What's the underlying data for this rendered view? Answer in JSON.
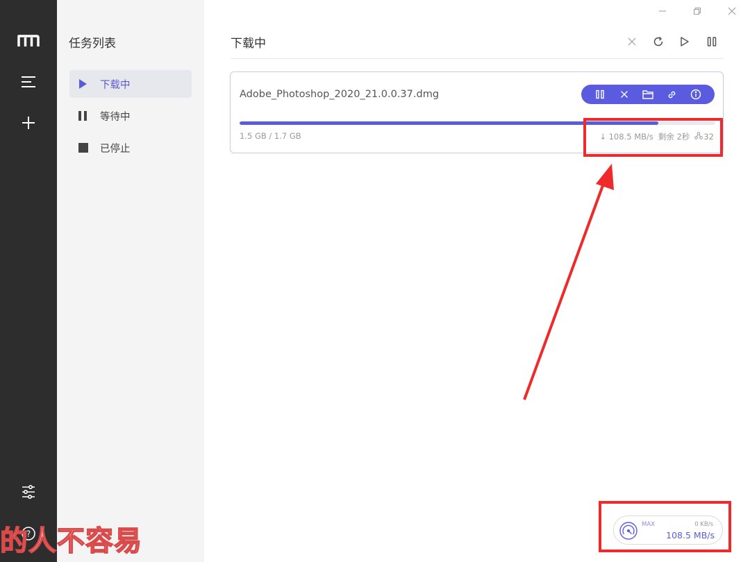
{
  "window_controls": {
    "minimize": "minimize-icon",
    "maximize": "maximize-icon",
    "close": "close-icon"
  },
  "rail": {
    "logo": "m-logo-icon",
    "menu": "menu-lines-icon",
    "add": "plus-icon",
    "settings": "sliders-icon",
    "help": "help-circle-icon"
  },
  "sidebar": {
    "title": "任务列表",
    "items": [
      {
        "label": "下载中",
        "icon": "play-icon",
        "active": true
      },
      {
        "label": "等待中",
        "icon": "pause-icon",
        "active": false
      },
      {
        "label": "已停止",
        "icon": "stop-icon",
        "active": false
      }
    ]
  },
  "main": {
    "title": "下载中",
    "header_actions": [
      "close-icon",
      "refresh-icon",
      "play-icon",
      "pause-icon"
    ]
  },
  "task": {
    "name": "Adobe_Photoshop_2020_21.0.0.37.dmg",
    "size": "1.5 GB / 1.7 GB",
    "progress": 0.88,
    "speed": "↓ 108.5 MB/s",
    "remaining": "剩余 2秒",
    "connections": "32",
    "actions": [
      "pause-icon",
      "close-icon",
      "folder-icon",
      "link-icon",
      "info-icon"
    ]
  },
  "speedometer": {
    "max_label": "MAX",
    "upload": "0 KB/s",
    "download": "108.5 MB/s"
  },
  "colors": {
    "accent": "#5b5bdf",
    "annotation": "#ee2a2a",
    "rail": "#2d2d2d"
  },
  "watermark": "的人不容易"
}
